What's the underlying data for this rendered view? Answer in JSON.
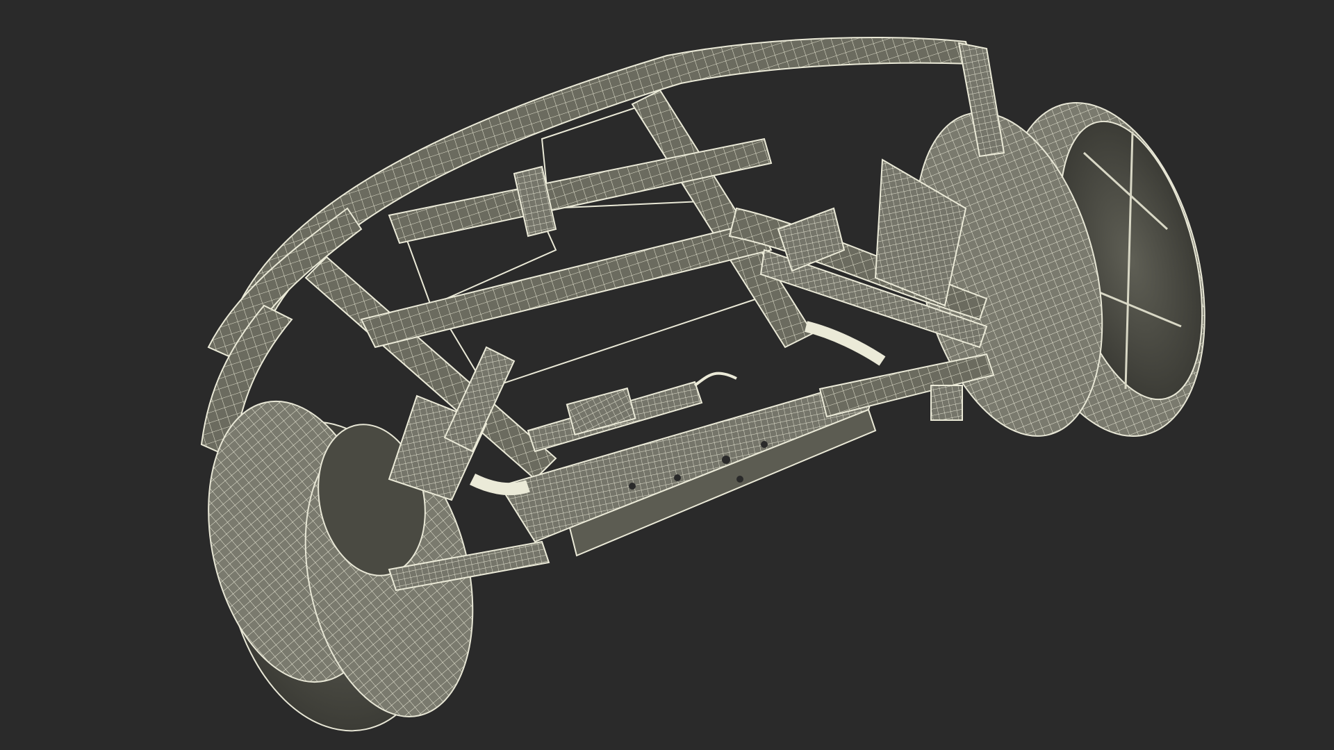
{
  "scene": {
    "subject": "chassis-wireframe-model",
    "colors": {
      "background": "#2a2a2a",
      "wire": "#e8e7d6",
      "surface": "#6f6f62",
      "surface_dark": "#505048",
      "shadow": "#3a3a34"
    }
  }
}
